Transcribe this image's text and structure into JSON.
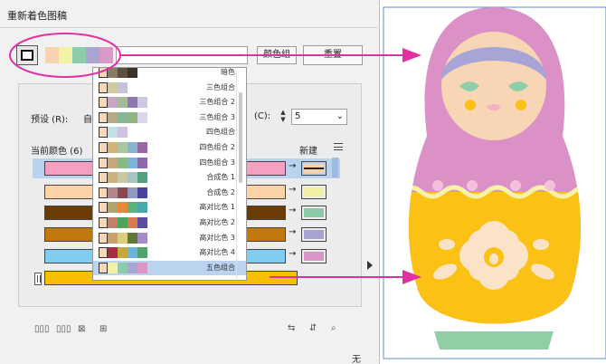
{
  "dialog": {
    "title": "重新着色图稿",
    "color_group_button": "颜色组",
    "reset_button": "重置",
    "preset_label": "预设 (R):",
    "preset_value_partial": "自",
    "colors_label": "(C):",
    "colors_value": "5",
    "current_colors_label": "当前颜色 (6)",
    "new_label": "新建",
    "bottom_right_text": "无"
  },
  "harmony_chips": [
    "#f6d2b1",
    "#f3f1a6",
    "#8ecbaa",
    "#a9a5d2",
    "#d89ac5"
  ],
  "dropdown": {
    "items": [
      {
        "name": "暗色",
        "swatches": [
          "#f6d7b8",
          "#8a7a63",
          "#5c4f40",
          "#3b3229"
        ]
      },
      {
        "name": "三色组合",
        "swatches": [
          "#f6d7b8",
          "#d3c99d",
          "#c6c2dc"
        ]
      },
      {
        "name": "三色组合 2",
        "swatches": [
          "#f6d7b8",
          "#c9a4c4",
          "#a3bb99",
          "#8e78b1",
          "#cfc6e1"
        ]
      },
      {
        "name": "三色组合 3",
        "swatches": [
          "#f6d7b8",
          "#b8a883",
          "#86b695",
          "#8fb57f",
          "#dcd6ea"
        ]
      },
      {
        "name": "四色组合",
        "swatches": [
          "#f6d7b8",
          "#bfdfe9",
          "#d0c0e2"
        ]
      },
      {
        "name": "四色组合 2",
        "swatches": [
          "#f6d7b8",
          "#d4b374",
          "#aac69e",
          "#86b6cf",
          "#9a67a5"
        ]
      },
      {
        "name": "四色组合 3",
        "swatches": [
          "#f6d7b8",
          "#c7a77b",
          "#87bb82",
          "#7ab3dc",
          "#8f68ab"
        ]
      },
      {
        "name": "合成色 1",
        "swatches": [
          "#f6d7b8",
          "#c8b37d",
          "#c9c8a3",
          "#a7c3c3",
          "#53a080"
        ]
      },
      {
        "name": "合成色 2",
        "swatches": [
          "#f6d7b8",
          "#b4858a",
          "#884b53",
          "#8f9ac2",
          "#47449a"
        ]
      },
      {
        "name": "高对比色 1",
        "swatches": [
          "#f6d7b8",
          "#b4a26e",
          "#e58a3d",
          "#59b47b",
          "#47a7ad"
        ]
      },
      {
        "name": "高对比色 2",
        "swatches": [
          "#f6d7b8",
          "#c47f69",
          "#4fa35d",
          "#d97a4c",
          "#5a4f9d"
        ]
      },
      {
        "name": "高对比色 3",
        "swatches": [
          "#f6d7b8",
          "#c9a06b",
          "#d9cf7a",
          "#5d7a3c",
          "#a58bc8"
        ]
      },
      {
        "name": "高对比色 4",
        "swatches": [
          "#f6d7b8",
          "#a92e3d",
          "#c6a73e",
          "#6ab4dd",
          "#4fa36b"
        ]
      },
      {
        "name": "五色组合",
        "swatches": [
          "#f6d7b8",
          "#f3f1a6",
          "#8ecbaa",
          "#a9a5d2",
          "#d89ac5"
        ]
      }
    ]
  },
  "current_colors": [
    {
      "current": "#f5a0c1",
      "new": "#fad3ac"
    },
    {
      "current": "#fcd2a8",
      "new": "#f4f0a3"
    },
    {
      "current": "#6a3d06",
      "new": "#8ccaa5"
    },
    {
      "current": "#c1790e",
      "new": "#a6a2d2"
    },
    {
      "current": "#80cdf0",
      "new": "#d796c4"
    },
    {
      "current": "#f8be00",
      "new": ""
    }
  ],
  "colors": {
    "accent_magenta": "#e22fa2",
    "doll_pink": "#db90c6",
    "doll_yellow": "#fbc115",
    "doll_face": "#f8d5b5",
    "doll_hair": "#a7a4d6",
    "doll_cheek": "#8ecfa9",
    "doll_base": "#90cea6",
    "doll_wave": "#f6f2a6"
  }
}
